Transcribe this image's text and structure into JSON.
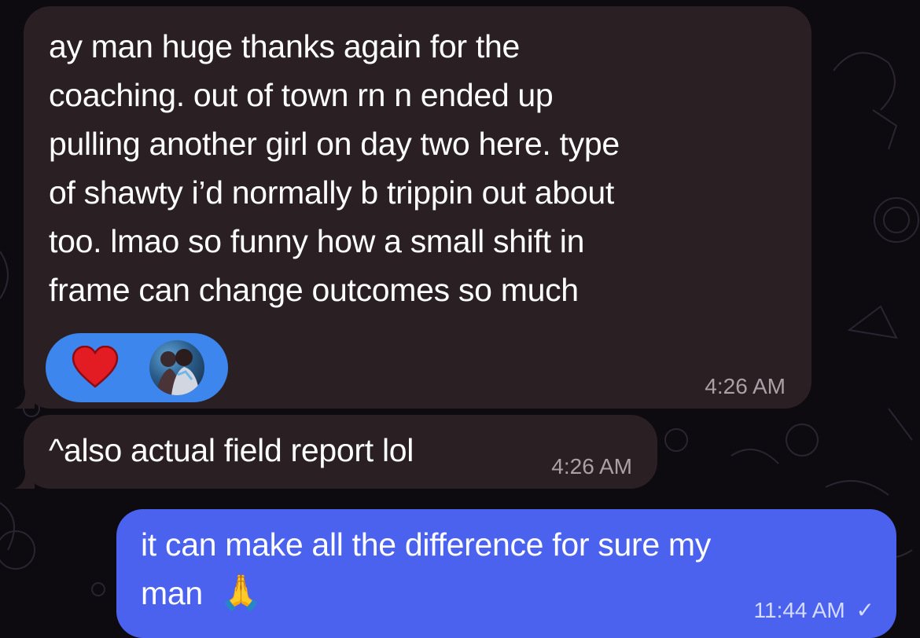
{
  "messages": [
    {
      "direction": "incoming",
      "lines": [
        "ay man huge thanks again for the",
        "coaching. out of town rn n ended up",
        "pulling another girl on day two here. type",
        "of shawty i’d normally b trippin out about",
        "too. lmao so funny how a small shift in",
        "frame can change outcomes so much"
      ],
      "time": "4:26 AM",
      "reaction": {
        "emoji": "heart-icon",
        "color": "#e31b23"
      }
    },
    {
      "direction": "incoming",
      "lines": [
        "^also actual field report lol"
      ],
      "time": "4:26 AM"
    },
    {
      "direction": "outgoing",
      "lines": [
        "it can make all the difference for sure my",
        "man"
      ],
      "emoji": "🙏",
      "time": "11:44 AM",
      "status": "✓"
    }
  ],
  "colors": {
    "background": "#0d0b10",
    "incoming_bubble": "#2a1f22",
    "outgoing_bubble": "#4a62ee",
    "reaction_pill": "#3d86ee"
  }
}
